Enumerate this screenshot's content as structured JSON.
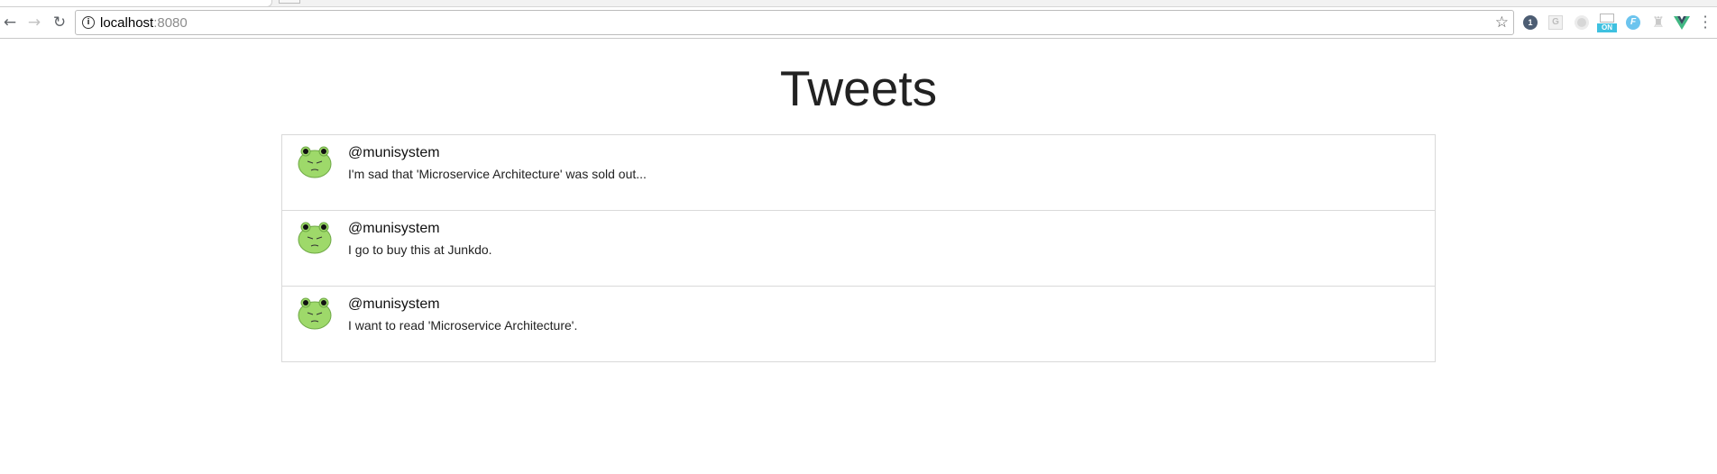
{
  "browser": {
    "address": {
      "host": "localhost",
      "port": ":8080"
    },
    "icons": {
      "back": "back-arrow-icon",
      "forward": "forward-arrow-icon",
      "reload": "reload-icon",
      "info": "info-icon",
      "bookmark": "star-icon",
      "menu": "kebab-menu-icon"
    },
    "extensions": {
      "first_badge": "1",
      "g_label": "G",
      "on_badge": "ON",
      "f_label": "F"
    }
  },
  "page": {
    "title": "Tweets"
  },
  "tweets": [
    {
      "user": "@munisystem",
      "text": "I'm sad that 'Microservice Architecture' was sold out..."
    },
    {
      "user": "@munisystem",
      "text": "I go to buy this at Junkdo."
    },
    {
      "user": "@munisystem",
      "text": "I want to read 'Microservice Architecture'."
    }
  ],
  "colors": {
    "avatar_face": "#9ed96a",
    "extension_blue": "#3fc1e0",
    "vue_green": "#41b883"
  }
}
